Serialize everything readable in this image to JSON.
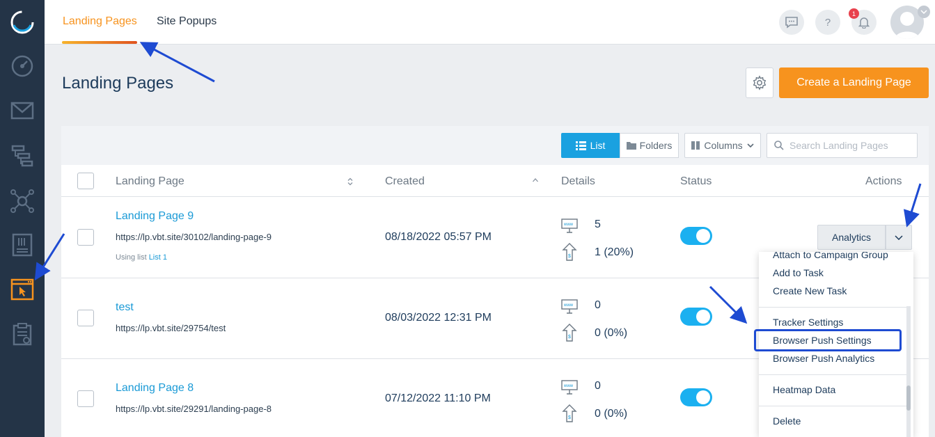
{
  "sidebar": {
    "items": [
      {
        "icon": "dashboard-gauge-icon"
      },
      {
        "icon": "email-envelope-icon"
      },
      {
        "icon": "automation-flow-icon"
      },
      {
        "icon": "network-hub-icon"
      },
      {
        "icon": "form-document-icon"
      },
      {
        "icon": "landing-page-browser-icon",
        "active": true
      },
      {
        "icon": "task-clipboard-icon"
      }
    ],
    "active_color": "#f7931e"
  },
  "topbar": {
    "tabs": [
      {
        "label": "Landing Pages",
        "active": true
      },
      {
        "label": "Site Popups",
        "active": false
      }
    ],
    "help_label": "?",
    "notification_count": "1"
  },
  "header": {
    "title": "Landing Pages",
    "create_button": "Create a Landing Page"
  },
  "toolbar": {
    "list_label": "List",
    "folders_label": "Folders",
    "columns_label": "Columns",
    "search_placeholder": "Search Landing Pages"
  },
  "table": {
    "columns": [
      "Landing Page",
      "Created",
      "Details",
      "Status",
      "Actions"
    ],
    "rows": [
      {
        "name": "Landing Page 9",
        "url": "https://lp.vbt.site/30102/landing-page-9",
        "list_prefix": "Using list",
        "list_name": "List 1",
        "created": "08/18/2022 05:57 PM",
        "views": "5",
        "conversions": "1 (20%)",
        "status_on": true
      },
      {
        "name": "test",
        "url": "https://lp.vbt.site/29754/test",
        "created": "08/03/2022 12:31 PM",
        "views": "0",
        "conversions": "0 (0%)",
        "status_on": true
      },
      {
        "name": "Landing Page 8",
        "url": "https://lp.vbt.site/29291/landing-page-8",
        "created": "07/12/2022 11:10 PM",
        "views": "0",
        "conversions": "0 (0%)",
        "status_on": true
      }
    ]
  },
  "actions": {
    "analytics_label": "Analytics",
    "menu": [
      "Attach to Campaign Group",
      "Add to Task",
      "Create New Task",
      "Tracker Settings",
      "Browser Push Settings",
      "Browser Push Analytics",
      "Heatmap Data",
      "Delete"
    ],
    "highlighted_item": "Browser Push Settings"
  },
  "colors": {
    "accent": "#f7931e",
    "primary_blue": "#1a9ad6",
    "toggle_on": "#1bb0f0",
    "sidebar_bg": "#243447",
    "annotation_arrow": "#1e4bd2"
  }
}
